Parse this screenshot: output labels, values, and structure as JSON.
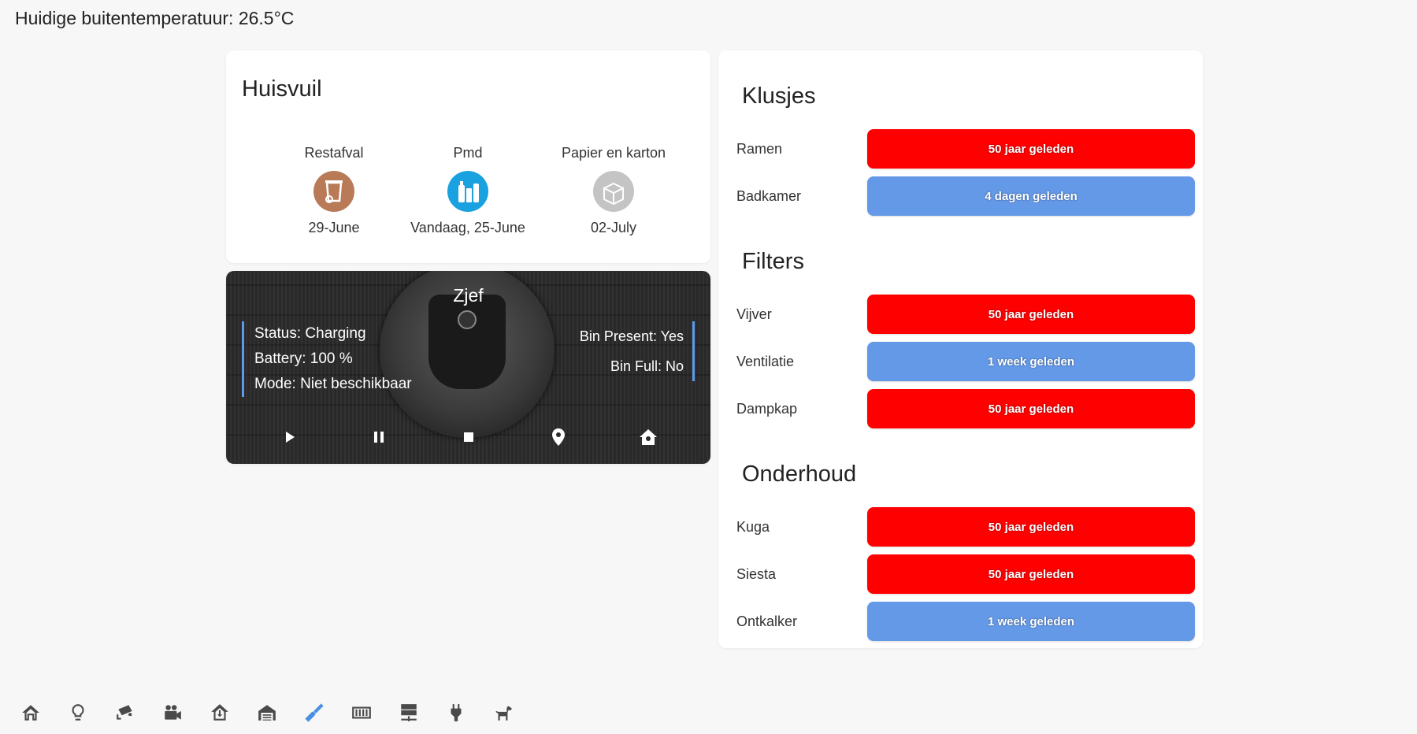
{
  "header": {
    "temperature_text": "Huidige buitentemperatuur: 26.5°C"
  },
  "waste": {
    "title": "Huisvuil",
    "bins": [
      {
        "label": "Restafval",
        "date": "29-June",
        "color": "#b97a57",
        "icon": "trash-bin-icon"
      },
      {
        "label": "Pmd",
        "date": "Vandaag, 25-June",
        "color": "#1aa1e0",
        "icon": "bottles-icon"
      },
      {
        "label": "Papier en karton",
        "date": "02-July",
        "color": "#c4c4c4",
        "icon": "box-icon"
      }
    ]
  },
  "vacuum": {
    "name": "Zjef",
    "status": "Status: Charging",
    "battery": "Battery: 100 %",
    "mode": "Mode: Niet beschikbaar",
    "bin_present": "Bin Present: Yes",
    "bin_full": "Bin Full: No",
    "controls": [
      "play-icon",
      "pause-icon",
      "stop-icon",
      "locate-icon",
      "return-home-icon"
    ],
    "accent": "#5b9bea"
  },
  "chores": {
    "sections": [
      {
        "title": "Klusjes",
        "rows": [
          {
            "label": "Ramen",
            "value": "50 jaar geleden",
            "status": "overdue"
          },
          {
            "label": "Badkamer",
            "value": "4 dagen geleden",
            "status": "ok"
          }
        ]
      },
      {
        "title": "Filters",
        "rows": [
          {
            "label": "Vijver",
            "value": "50 jaar geleden",
            "status": "overdue"
          },
          {
            "label": "Ventilatie",
            "value": "1 week geleden",
            "status": "ok"
          },
          {
            "label": "Dampkap",
            "value": "50 jaar geleden",
            "status": "overdue"
          }
        ]
      },
      {
        "title": "Onderhoud",
        "rows": [
          {
            "label": "Kuga",
            "value": "50 jaar geleden",
            "status": "overdue"
          },
          {
            "label": "Siesta",
            "value": "50 jaar geleden",
            "status": "overdue"
          },
          {
            "label": "Ontkalker",
            "value": "1 week geleden",
            "status": "ok"
          }
        ]
      }
    ],
    "colors": {
      "overdue": "#ff0000",
      "ok": "#6499e8"
    }
  },
  "nav": {
    "items": [
      "home-icon",
      "lightbulb-icon",
      "cctv-icon",
      "movie-camera-icon",
      "home-import-icon",
      "garage-icon",
      "broom-icon",
      "radiator-icon",
      "server-icon",
      "power-plug-icon",
      "dog-icon"
    ],
    "active_index": 6,
    "active_color": "#4a90e2",
    "inactive_color": "#4a4a4a"
  }
}
